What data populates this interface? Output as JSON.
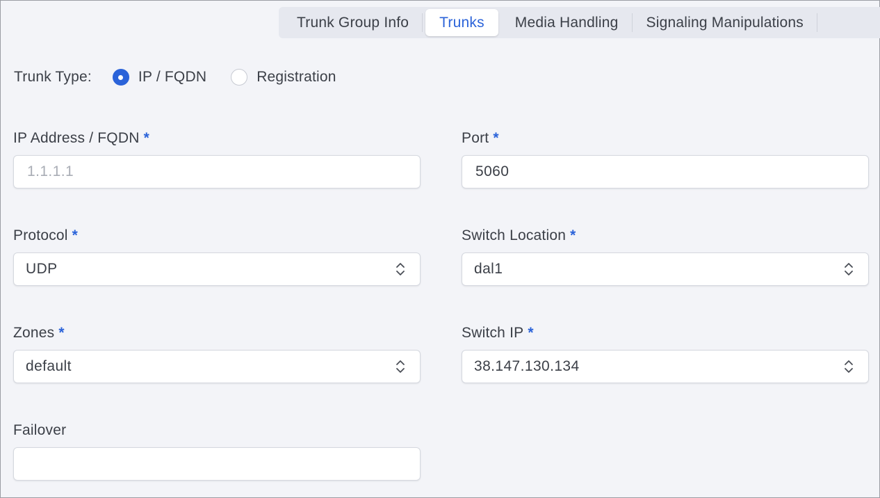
{
  "tabs": [
    {
      "label": "Trunk Group Info",
      "active": false
    },
    {
      "label": "Trunks",
      "active": true
    },
    {
      "label": "Media Handling",
      "active": false
    },
    {
      "label": "Signaling Manipulations",
      "active": false
    }
  ],
  "trunk_type": {
    "label": "Trunk Type:",
    "options": [
      {
        "label": "IP / FQDN",
        "selected": true
      },
      {
        "label": "Registration",
        "selected": false
      }
    ]
  },
  "fields": {
    "ip_address": {
      "label": "IP Address / FQDN",
      "required_mark": "*",
      "value": "",
      "placeholder": "1.1.1.1"
    },
    "port": {
      "label": "Port",
      "required_mark": "*",
      "value": "5060",
      "placeholder": ""
    },
    "protocol": {
      "label": "Protocol",
      "required_mark": "*",
      "value": "UDP"
    },
    "switch_location": {
      "label": "Switch Location",
      "required_mark": "*",
      "value": "dal1"
    },
    "zones": {
      "label": "Zones",
      "required_mark": "*",
      "value": "default"
    },
    "switch_ip": {
      "label": "Switch IP",
      "required_mark": "*",
      "value": "38.147.130.134"
    },
    "failover": {
      "label": "Failover",
      "value": "",
      "placeholder": ""
    }
  },
  "colors": {
    "accent": "#2b63d9",
    "background": "#f3f4f8",
    "text": "#3b3f47"
  }
}
